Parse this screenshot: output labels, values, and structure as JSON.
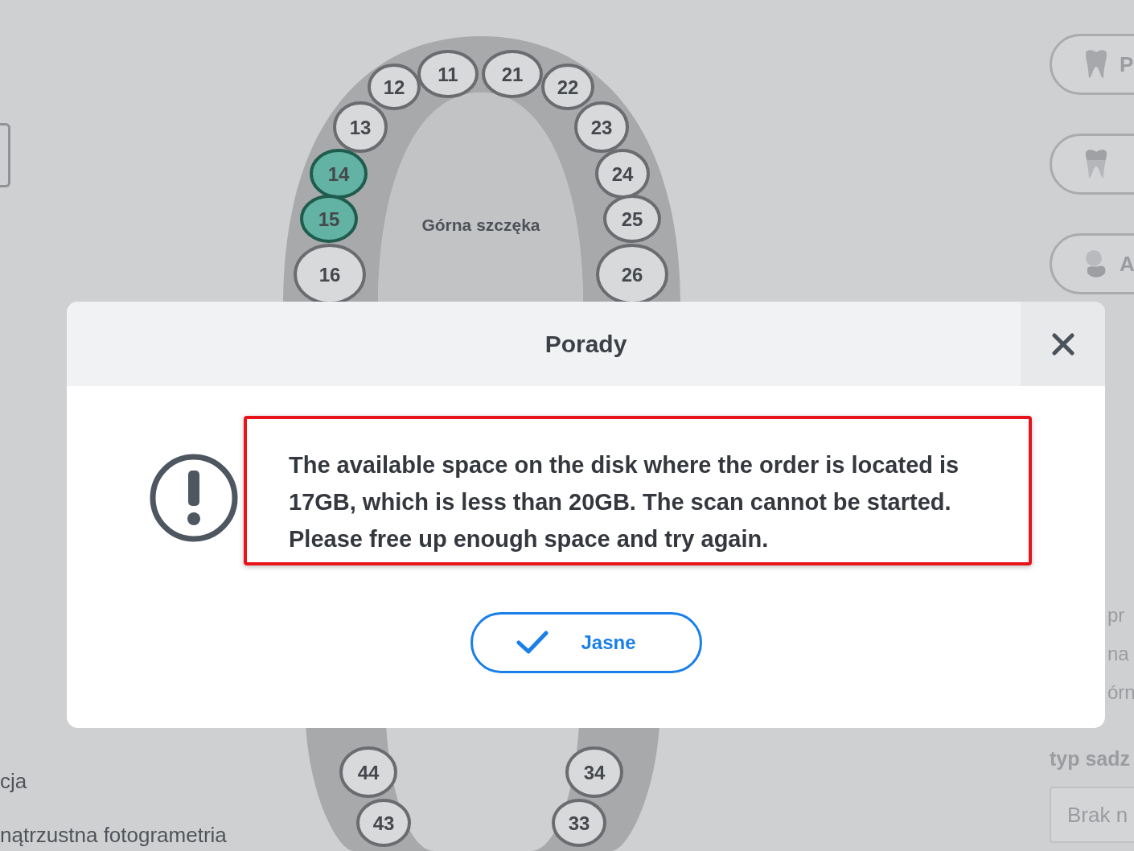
{
  "left_panel": {
    "texts": [
      "cja",
      "nątrzustna fotogrametria"
    ]
  },
  "jaw_chart": {
    "upper_label": "Górna szczęka",
    "upper_teeth": [
      {
        "label": "11",
        "selected": false
      },
      {
        "label": "21",
        "selected": false
      },
      {
        "label": "12",
        "selected": false
      },
      {
        "label": "22",
        "selected": false
      },
      {
        "label": "13",
        "selected": false
      },
      {
        "label": "23",
        "selected": false
      },
      {
        "label": "14",
        "selected": true
      },
      {
        "label": "24",
        "selected": false
      },
      {
        "label": "15",
        "selected": true
      },
      {
        "label": "25",
        "selected": false
      },
      {
        "label": "16",
        "selected": false
      },
      {
        "label": "26",
        "selected": false
      }
    ],
    "lower_teeth": [
      {
        "label": "44",
        "selected": false
      },
      {
        "label": "34",
        "selected": false
      },
      {
        "label": "43",
        "selected": false
      },
      {
        "label": "33",
        "selected": false
      }
    ]
  },
  "right_panel": {
    "tool_buttons": [
      {
        "kind": "tooth",
        "label": "P"
      },
      {
        "kind": "crown"
      },
      {
        "kind": "implant",
        "label": "A"
      }
    ],
    "field_labels": [
      "pr",
      "na",
      "órn"
    ],
    "type_label": "typ sadz",
    "type_select": {
      "value": "Brak n"
    }
  },
  "dialog": {
    "title": "Porady",
    "message": "The available space on the disk where the order is located is 17GB, which is less than 20GB. The scan cannot be started. Please free up enough space and try again.",
    "button": "Jasne"
  }
}
